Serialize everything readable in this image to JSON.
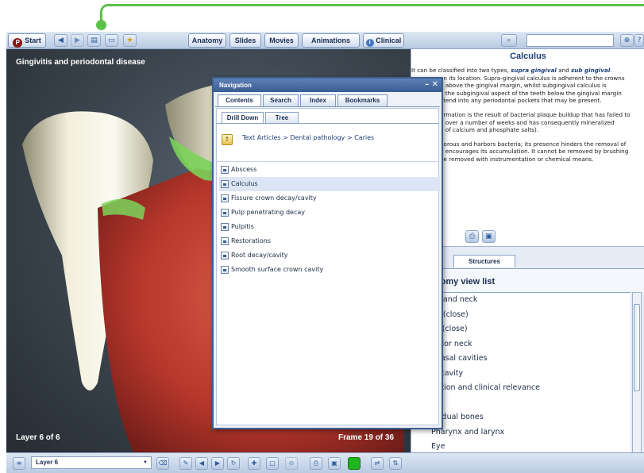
{
  "toolbar": {
    "start_label": "Start",
    "anatomy_label": "Anatomy",
    "slides_label": "Slides",
    "movies_label": "Movies",
    "animations_label": "Animations",
    "clinical_label": "Clinical",
    "search_value": ""
  },
  "viewport": {
    "title": "Gingivitis and periodontal disease",
    "layer_text": "Layer 6 of 6",
    "frame_text": "Frame 19 of 36"
  },
  "navigation": {
    "title": "Navigation",
    "tabs": [
      "Contents",
      "Search",
      "Index",
      "Bookmarks"
    ],
    "subtabs": [
      "Drill Down",
      "Tree"
    ],
    "breadcrumb": "Text Articles > Dental pathology > Caries",
    "items": [
      "Abscess",
      "Calculus",
      "Fissure crown decay/cavity",
      "Pulp penetrating decay",
      "Pulpitis",
      "Restorations",
      "Root decay/cavity",
      "Smooth surface crown cavity"
    ],
    "selected_item": "Calculus"
  },
  "article": {
    "title": "Calculus",
    "p1_l1a": "It can be classified into two types, ",
    "p1_l1b": "supra gingival",
    "p1_l1c": " and ",
    "p1_l1d": "sub gingival",
    "p1_l1e": ".",
    "p1_l2": "on its location. Supra-gingival calculus is adherent to the crowns",
    "p1_l3": "h above the gingival margin, whilst subgingival calculus is",
    "p1_l4": "n the subgingival aspect of the teeth below the gingival margin",
    "p1_l5": "xtend into any periodontal pockets that may be present.",
    "p2_l1": "ormation is the result of bacterial plaque buildup that has failed to",
    "p2_l2": "d over a number of weeks and has consequently mineralized",
    "p2_l3": "n of calcium and phosphate salts).",
    "p3_l1": "porous and harbors bacteria; its presence hinders the removal of",
    "p3_l2": "d encourages its accumulation. It cannot be removed by brushing",
    "p3_l3": "be removed with instrumentation or chemical means."
  },
  "structures": {
    "tab_label": "Structures",
    "heading": "tomy view list",
    "items": [
      "ad and neck",
      "ad (close)",
      "ck (close)",
      "terior neck",
      "anasal cavities",
      "al cavity",
      "ntition and clinical relevance",
      "ll",
      "lividual bones",
      "Pharynx and larynx",
      "Eye"
    ]
  },
  "bottom_toolbar": {
    "layer_value": "Layer 6"
  },
  "colors": {
    "accent_green": "#5cc24a",
    "toolbar_blue": "#b9cbe2",
    "nav_title_blue": "#3a5d94",
    "link_blue": "#1e3f7a"
  },
  "icons": [
    "start-logo-icon",
    "back-icon",
    "forward-icon",
    "document-icon",
    "window-icon",
    "favorites-icon",
    "info-icon",
    "search-icon",
    "zoom-icon",
    "help-icon",
    "up-folder-icon",
    "print-icon",
    "save-icon",
    "minimize-icon",
    "close-icon"
  ]
}
